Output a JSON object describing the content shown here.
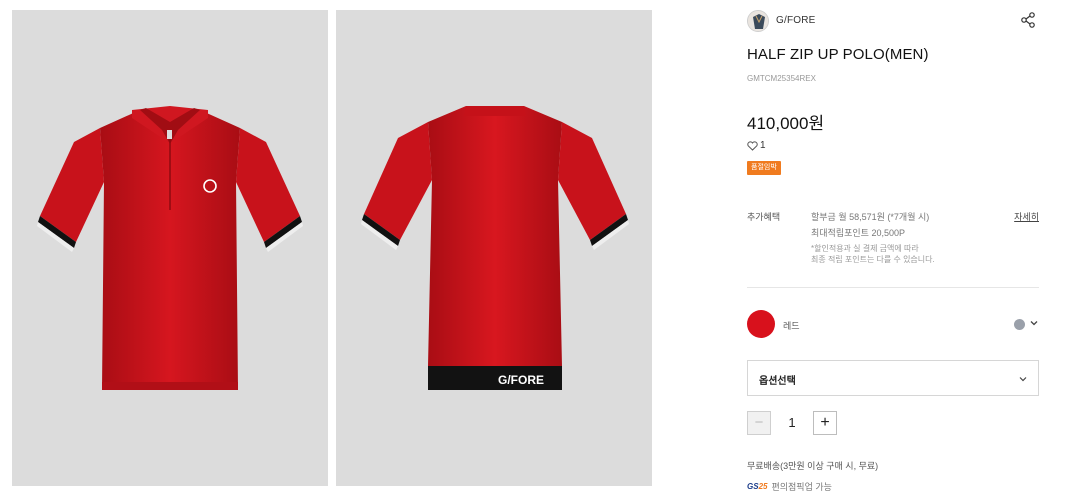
{
  "brand": {
    "name": "G/FORE",
    "avatar_icon": "brand-avatar-icon"
  },
  "product": {
    "title": "HALF ZIP UP POLO(MEN)",
    "code": "GMTCM25354REX",
    "price": "410,000원",
    "likes": "1",
    "badge": "품절임박"
  },
  "back_print": "G/FORE",
  "benefits": {
    "label": "추가혜택",
    "installment": "할부금 월 58,571원 (*7개월 시)",
    "points": "최대적립포인트 20,500P",
    "note_1": "*할인적용과 실 결제 금액에 따라",
    "note_2": "최종 적립 포인트는 다를 수 있습니다.",
    "detail_link": "자세히"
  },
  "color": {
    "selected_name": "레드",
    "selected_hex": "#d8111c",
    "alt_hex": "#9aa0aa"
  },
  "option_select": {
    "label": "옵션선택"
  },
  "quantity": {
    "value": "1",
    "minus": "−",
    "plus": "+"
  },
  "shipping": {
    "text": "무료배송(3만원 이상 구매 시, 무료)"
  },
  "pickup": {
    "logo_prefix": "GS",
    "logo_suffix": "25",
    "text": "편의점픽업 가능"
  }
}
